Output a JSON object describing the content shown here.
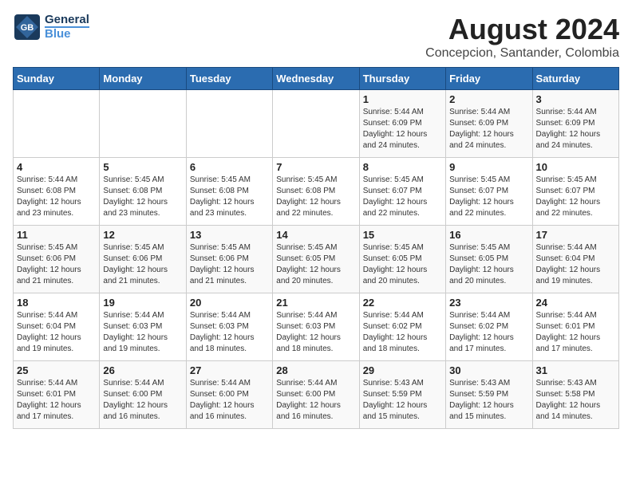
{
  "logo": {
    "line1": "General",
    "line2": "Blue"
  },
  "title": "August 2024",
  "subtitle": "Concepcion, Santander, Colombia",
  "headers": [
    "Sunday",
    "Monday",
    "Tuesday",
    "Wednesday",
    "Thursday",
    "Friday",
    "Saturday"
  ],
  "weeks": [
    [
      {
        "day": "",
        "info": ""
      },
      {
        "day": "",
        "info": ""
      },
      {
        "day": "",
        "info": ""
      },
      {
        "day": "",
        "info": ""
      },
      {
        "day": "1",
        "info": "Sunrise: 5:44 AM\nSunset: 6:09 PM\nDaylight: 12 hours\nand 24 minutes."
      },
      {
        "day": "2",
        "info": "Sunrise: 5:44 AM\nSunset: 6:09 PM\nDaylight: 12 hours\nand 24 minutes."
      },
      {
        "day": "3",
        "info": "Sunrise: 5:44 AM\nSunset: 6:09 PM\nDaylight: 12 hours\nand 24 minutes."
      }
    ],
    [
      {
        "day": "4",
        "info": "Sunrise: 5:44 AM\nSunset: 6:08 PM\nDaylight: 12 hours\nand 23 minutes."
      },
      {
        "day": "5",
        "info": "Sunrise: 5:45 AM\nSunset: 6:08 PM\nDaylight: 12 hours\nand 23 minutes."
      },
      {
        "day": "6",
        "info": "Sunrise: 5:45 AM\nSunset: 6:08 PM\nDaylight: 12 hours\nand 23 minutes."
      },
      {
        "day": "7",
        "info": "Sunrise: 5:45 AM\nSunset: 6:08 PM\nDaylight: 12 hours\nand 22 minutes."
      },
      {
        "day": "8",
        "info": "Sunrise: 5:45 AM\nSunset: 6:07 PM\nDaylight: 12 hours\nand 22 minutes."
      },
      {
        "day": "9",
        "info": "Sunrise: 5:45 AM\nSunset: 6:07 PM\nDaylight: 12 hours\nand 22 minutes."
      },
      {
        "day": "10",
        "info": "Sunrise: 5:45 AM\nSunset: 6:07 PM\nDaylight: 12 hours\nand 22 minutes."
      }
    ],
    [
      {
        "day": "11",
        "info": "Sunrise: 5:45 AM\nSunset: 6:06 PM\nDaylight: 12 hours\nand 21 minutes."
      },
      {
        "day": "12",
        "info": "Sunrise: 5:45 AM\nSunset: 6:06 PM\nDaylight: 12 hours\nand 21 minutes."
      },
      {
        "day": "13",
        "info": "Sunrise: 5:45 AM\nSunset: 6:06 PM\nDaylight: 12 hours\nand 21 minutes."
      },
      {
        "day": "14",
        "info": "Sunrise: 5:45 AM\nSunset: 6:05 PM\nDaylight: 12 hours\nand 20 minutes."
      },
      {
        "day": "15",
        "info": "Sunrise: 5:45 AM\nSunset: 6:05 PM\nDaylight: 12 hours\nand 20 minutes."
      },
      {
        "day": "16",
        "info": "Sunrise: 5:45 AM\nSunset: 6:05 PM\nDaylight: 12 hours\nand 20 minutes."
      },
      {
        "day": "17",
        "info": "Sunrise: 5:44 AM\nSunset: 6:04 PM\nDaylight: 12 hours\nand 19 minutes."
      }
    ],
    [
      {
        "day": "18",
        "info": "Sunrise: 5:44 AM\nSunset: 6:04 PM\nDaylight: 12 hours\nand 19 minutes."
      },
      {
        "day": "19",
        "info": "Sunrise: 5:44 AM\nSunset: 6:03 PM\nDaylight: 12 hours\nand 19 minutes."
      },
      {
        "day": "20",
        "info": "Sunrise: 5:44 AM\nSunset: 6:03 PM\nDaylight: 12 hours\nand 18 minutes."
      },
      {
        "day": "21",
        "info": "Sunrise: 5:44 AM\nSunset: 6:03 PM\nDaylight: 12 hours\nand 18 minutes."
      },
      {
        "day": "22",
        "info": "Sunrise: 5:44 AM\nSunset: 6:02 PM\nDaylight: 12 hours\nand 18 minutes."
      },
      {
        "day": "23",
        "info": "Sunrise: 5:44 AM\nSunset: 6:02 PM\nDaylight: 12 hours\nand 17 minutes."
      },
      {
        "day": "24",
        "info": "Sunrise: 5:44 AM\nSunset: 6:01 PM\nDaylight: 12 hours\nand 17 minutes."
      }
    ],
    [
      {
        "day": "25",
        "info": "Sunrise: 5:44 AM\nSunset: 6:01 PM\nDaylight: 12 hours\nand 17 minutes."
      },
      {
        "day": "26",
        "info": "Sunrise: 5:44 AM\nSunset: 6:00 PM\nDaylight: 12 hours\nand 16 minutes."
      },
      {
        "day": "27",
        "info": "Sunrise: 5:44 AM\nSunset: 6:00 PM\nDaylight: 12 hours\nand 16 minutes."
      },
      {
        "day": "28",
        "info": "Sunrise: 5:44 AM\nSunset: 6:00 PM\nDaylight: 12 hours\nand 16 minutes."
      },
      {
        "day": "29",
        "info": "Sunrise: 5:43 AM\nSunset: 5:59 PM\nDaylight: 12 hours\nand 15 minutes."
      },
      {
        "day": "30",
        "info": "Sunrise: 5:43 AM\nSunset: 5:59 PM\nDaylight: 12 hours\nand 15 minutes."
      },
      {
        "day": "31",
        "info": "Sunrise: 5:43 AM\nSunset: 5:58 PM\nDaylight: 12 hours\nand 14 minutes."
      }
    ]
  ]
}
